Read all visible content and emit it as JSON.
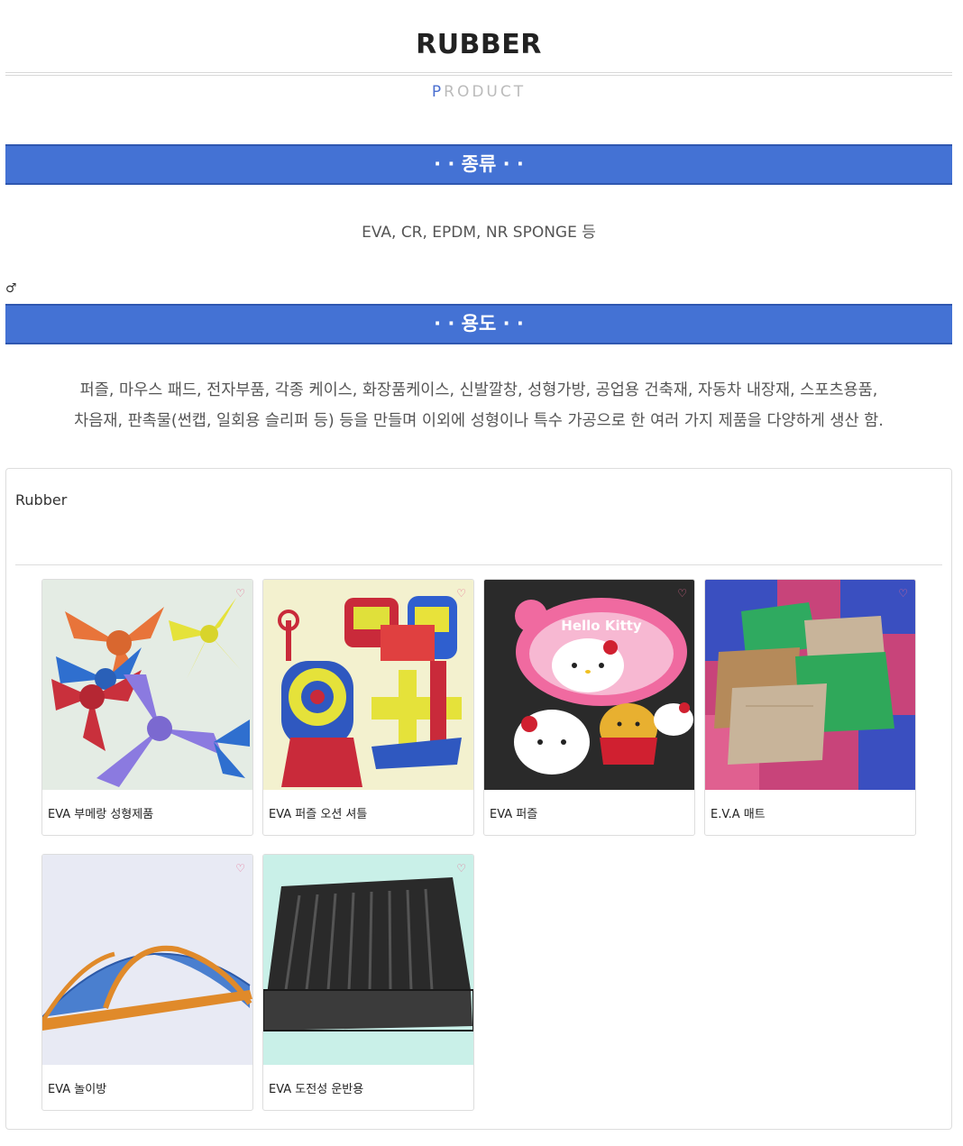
{
  "header": {
    "title": "RUBBER",
    "subtitle_first": "P",
    "subtitle_rest": "RODUCT"
  },
  "section_kinds": {
    "heading": "· · 종류 · ·",
    "text": "EVA, CR, EPDM, NR SPONGE 등"
  },
  "stray_glyph": "♂",
  "section_usage": {
    "heading": "· · 용도 · ·",
    "line1": "퍼즐, 마우스 패드, 전자부품, 각종 케이스, 화장품케이스, 신발깔창, 성형가방, 공업용 건축재, 자동차 내장재, 스포츠용품,",
    "line2": "차음재, 판촉물(썬캡, 일회용 슬리퍼 등) 등을 만들며 이외에 성형이나 특수 가공으로 한 여러 가지 제품을 다양하게 생산 함."
  },
  "gallery": {
    "title": "Rubber",
    "items": [
      {
        "caption": "EVA 부메랑 성형제품",
        "icon": "heart-icon"
      },
      {
        "caption": "EVA 퍼즐 오션 셔틀",
        "icon": "heart-icon"
      },
      {
        "caption": "EVA 퍼즐",
        "icon": "heart-icon"
      },
      {
        "caption": "E.V.A 매트",
        "icon": "heart-icon"
      },
      {
        "caption": "EVA 놀이방",
        "icon": "heart-icon"
      },
      {
        "caption": "EVA 도전성 운반용",
        "icon": "heart-icon"
      }
    ]
  },
  "colors": {
    "section_bar": "#4472d4",
    "accent_letter": "#4a6fd0",
    "heart": "#e66a8f"
  }
}
